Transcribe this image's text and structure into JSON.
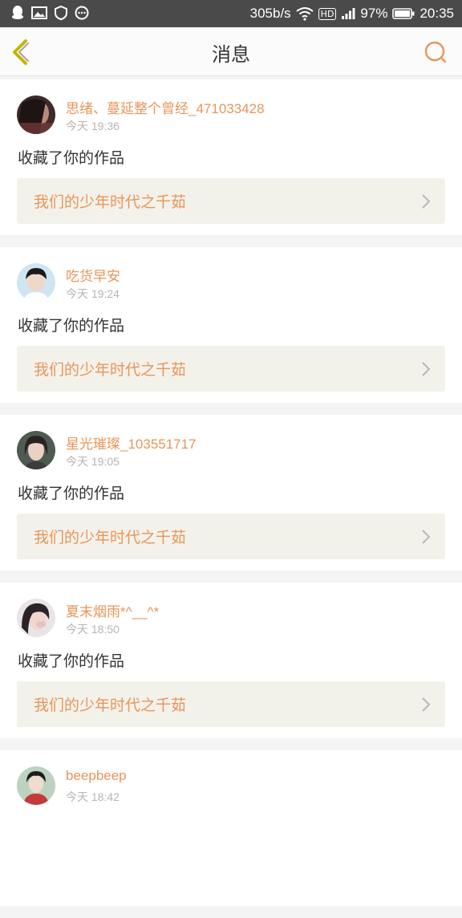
{
  "status_bar": {
    "net_speed": "305b/s",
    "battery": "97%",
    "time": "20:35",
    "network_type": "HD"
  },
  "navbar": {
    "title": "消息",
    "back_icon": "chevron-left-icon",
    "search_icon": "search-icon"
  },
  "colors": {
    "accent": "#e8955a",
    "back_arrow": "#c9b400",
    "status_bg": "#4a4a4a",
    "work_bg": "#f3f2ea"
  },
  "messages": [
    {
      "user": "思绪、蔓延整个曾经_471033428",
      "time": "今天 19:36",
      "action": "收藏了你的作品",
      "work": "我们的少年时代之千茹"
    },
    {
      "user": "吃货早安",
      "time": "今天 19:24",
      "action": "收藏了你的作品",
      "work": "我们的少年时代之千茹"
    },
    {
      "user": "星光璀璨_103551717",
      "time": "今天 19:05",
      "action": "收藏了你的作品",
      "work": "我们的少年时代之千茹"
    },
    {
      "user": "夏末烟雨*^__^*",
      "time": "今天 18:50",
      "action": "收藏了你的作品",
      "work": "我们的少年时代之千茹"
    },
    {
      "user": "beepbeep",
      "time": "今天 18:42",
      "action": "",
      "work": ""
    }
  ]
}
